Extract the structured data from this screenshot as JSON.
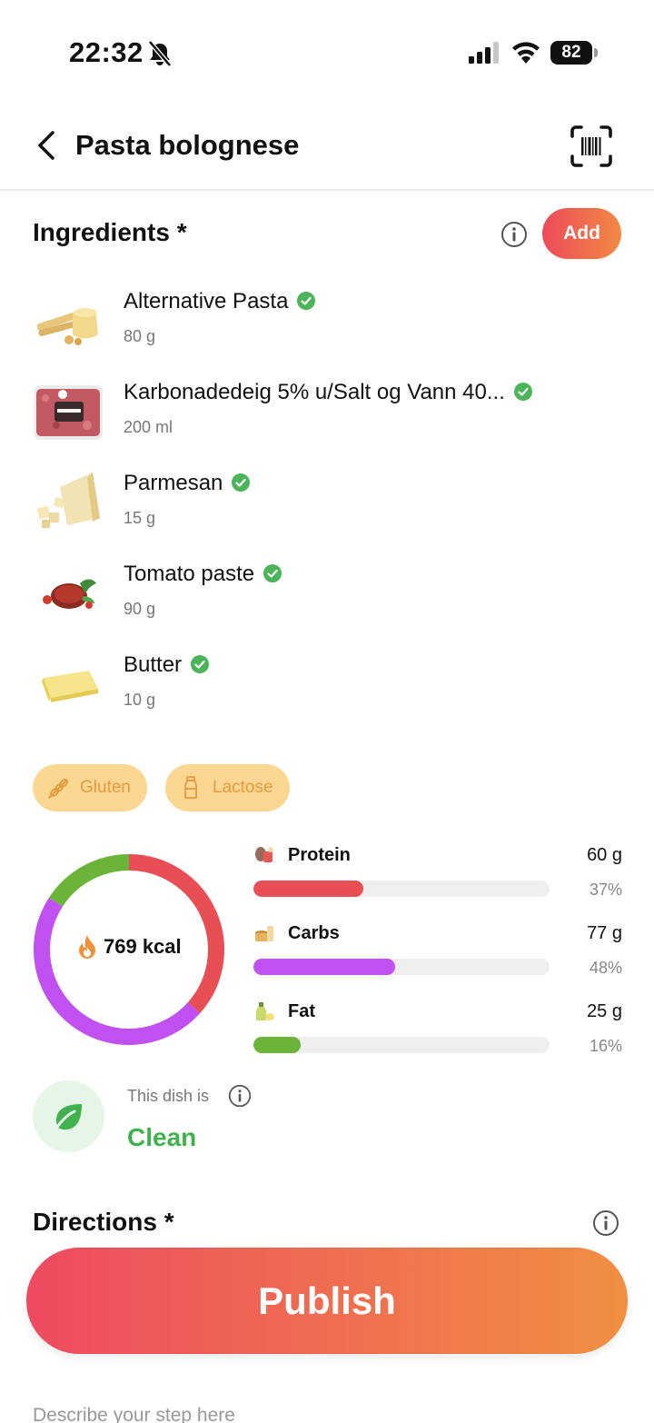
{
  "status_bar": {
    "time": "22:32",
    "battery": "82"
  },
  "header": {
    "title": "Pasta bolognese"
  },
  "ingredients": {
    "title": "Ingredients *",
    "add_label": "Add",
    "items": [
      {
        "name": "Alternative Pasta",
        "amount": "80 g",
        "verified": true
      },
      {
        "name": "Karbonadedeig 5% u/Salt og Vann 40...",
        "amount": "200 ml",
        "verified": true
      },
      {
        "name": "Parmesan",
        "amount": "15 g",
        "verified": true
      },
      {
        "name": "Tomato paste",
        "amount": "90 g",
        "verified": true
      },
      {
        "name": "Butter",
        "amount": "10 g",
        "verified": true
      }
    ]
  },
  "allergens": [
    {
      "label": "Gluten",
      "icon": "wheat-icon"
    },
    {
      "label": "Lactose",
      "icon": "milk-bottle-icon"
    }
  ],
  "nutrition": {
    "kcal": "769 kcal",
    "macros": [
      {
        "label": "Protein",
        "value": "60 g",
        "percent": "37%",
        "fraction": 0.37,
        "color": "#e84f55"
      },
      {
        "label": "Carbs",
        "value": "77 g",
        "percent": "48%",
        "fraction": 0.48,
        "color": "#c050f0"
      },
      {
        "label": "Fat",
        "value": "25 g",
        "percent": "16%",
        "fraction": 0.16,
        "color": "#6cb33a"
      }
    ]
  },
  "dish_status": {
    "caption": "This dish is",
    "value": "Clean",
    "color": "#3fb24d"
  },
  "directions": {
    "title": "Directions *",
    "step_placeholder": "Describe your step here"
  },
  "publish_label": "Publish"
}
